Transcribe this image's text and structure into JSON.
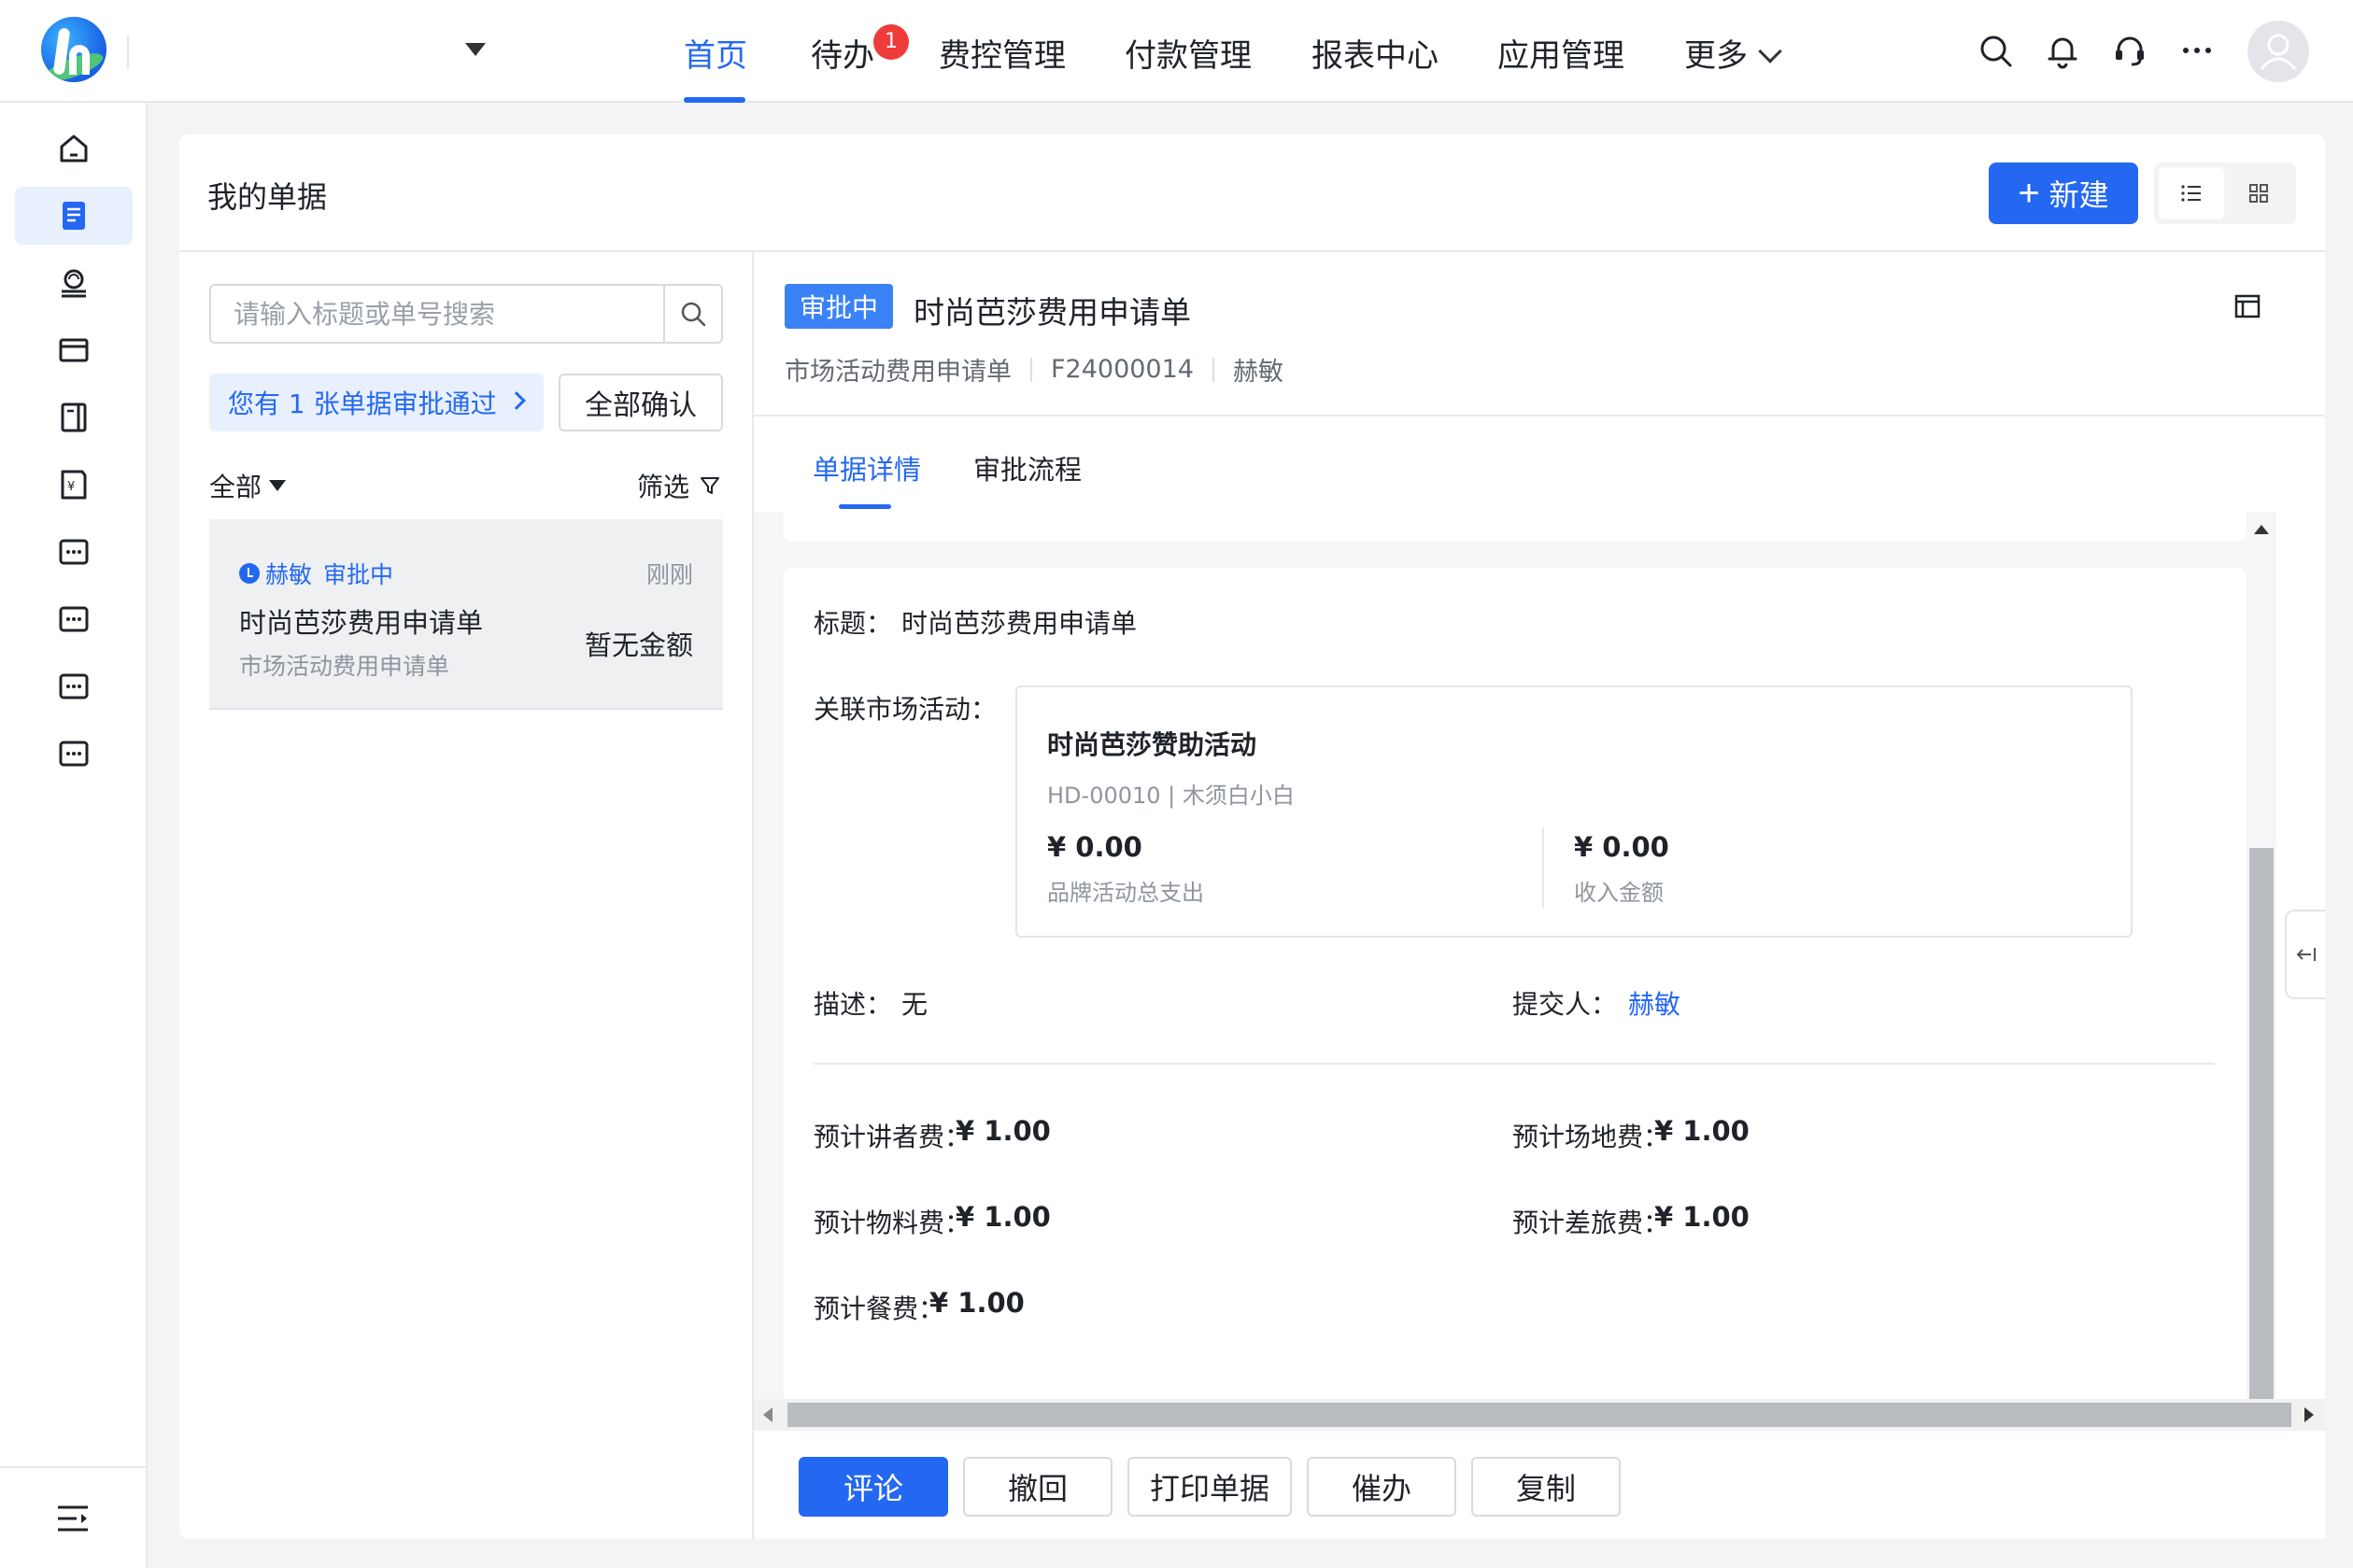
{
  "colors": {
    "accent": "#2468f2",
    "badge": "#f03b3b",
    "status_tag": "#3b82f6"
  },
  "nav": {
    "items": [
      {
        "label": "首页",
        "active": true
      },
      {
        "label": "待办",
        "badge": "1"
      },
      {
        "label": "费控管理"
      },
      {
        "label": "付款管理"
      },
      {
        "label": "报表中心"
      },
      {
        "label": "应用管理"
      },
      {
        "label": "更多"
      }
    ]
  },
  "top_icons": [
    "search-icon",
    "bell-icon",
    "headset-icon",
    "more-icon",
    "avatar-icon"
  ],
  "rail_icons": [
    "home-icon",
    "document-icon",
    "stamp-icon",
    "wallet-icon",
    "ledger-icon",
    "receipt-icon",
    "app-icon",
    "app-icon",
    "app-icon",
    "app-icon",
    "collapse-menu-icon"
  ],
  "page": {
    "title": "我的单据",
    "new_button": "新建"
  },
  "list": {
    "search_placeholder": "请输入标题或单号搜索",
    "notice": "您有 1 张单据审批通过",
    "confirm_all": "全部确认",
    "filter_all": "全部",
    "filter": "筛选",
    "items": [
      {
        "submitter": "赫敏",
        "status": "审批中",
        "time": "刚刚",
        "title": "时尚芭莎费用申请单",
        "type": "市场活动费用申请单",
        "amount": "暂无金额"
      }
    ]
  },
  "detail": {
    "status": "审批中",
    "title": "时尚芭莎费用申请单",
    "meta": {
      "type": "市场活动费用申请单",
      "number": "F24000014",
      "submitter": "赫敏"
    },
    "tabs": [
      "单据详情",
      "审批流程"
    ],
    "form": {
      "title_label": "标题：",
      "title_value": "时尚芭莎费用申请单",
      "activity_label": "关联市场活动：",
      "activity": {
        "name": "时尚芭莎赞助活动",
        "code": "HD-00010 | 木须白小白",
        "amount1": "¥ 0.00",
        "amount1_label": "品牌活动总支出",
        "amount2": "¥ 0.00",
        "amount2_label": "收入金额"
      },
      "desc_label": "描述：",
      "desc_value": "无",
      "submitter_label": "提交人：",
      "submitter_value": "赫敏",
      "fees": [
        {
          "label": "预计讲者费：",
          "value": "¥ 1.00"
        },
        {
          "label": "预计场地费：",
          "value": "¥ 1.00"
        },
        {
          "label": "预计物料费：",
          "value": "¥ 1.00"
        },
        {
          "label": "预计差旅费：",
          "value": "¥ 1.00"
        },
        {
          "label": "预计餐费：",
          "value": "¥ 1.00"
        }
      ]
    },
    "actions": [
      "评论",
      "撤回",
      "打印单据",
      "催办",
      "复制"
    ]
  }
}
